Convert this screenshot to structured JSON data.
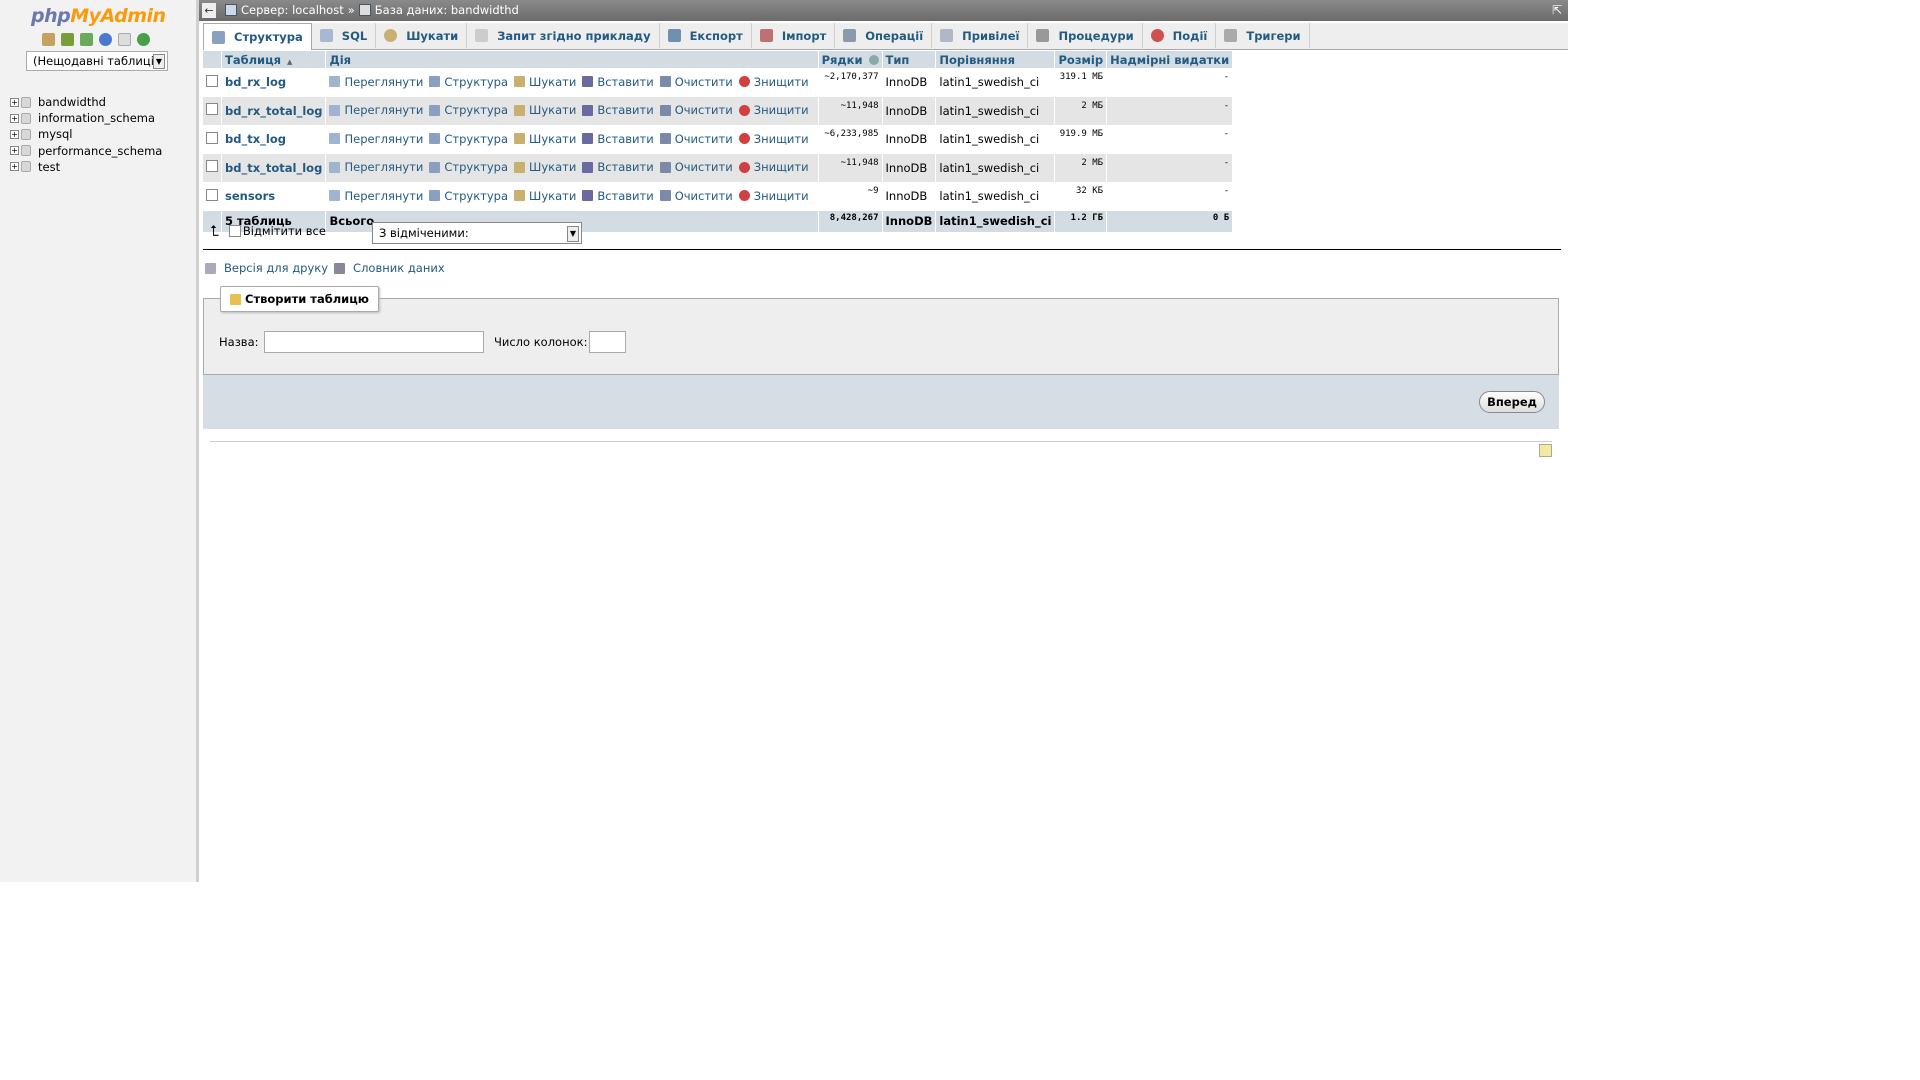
{
  "nav": {
    "logo_php": "php",
    "logo_myadmin": "MyAdmin",
    "recent_tables": "(Нещодавні таблиці)",
    "databases": [
      "bandwidthd",
      "information_schema",
      "mysql",
      "performance_schema",
      "test"
    ]
  },
  "serverinfo": {
    "server": "Сервер: localhost",
    "separator": "»",
    "database": "База даних: bandwidthd"
  },
  "tabs": [
    "Структура",
    "SQL",
    "Шукати",
    "Запит згідно прикладу",
    "Експорт",
    "Імпорт",
    "Операції",
    "Привілеї",
    "Процедури",
    "Події",
    "Тригери"
  ],
  "table": {
    "headers": {
      "table": "Таблиця",
      "action": "Дія",
      "rows": "Рядки",
      "type": "Тип",
      "collation": "Порівняння",
      "size": "Розмір",
      "overhead": "Надмірні видатки"
    },
    "actions": [
      "Переглянути",
      "Структура",
      "Шукати",
      "Вставити",
      "Очистити",
      "Знищити"
    ],
    "rows": [
      {
        "name": "bd_rx_log",
        "rows": "~2,170,377",
        "type": "InnoDB",
        "collation": "latin1_swedish_ci",
        "size": "319.1 МБ",
        "overhead": "-"
      },
      {
        "name": "bd_rx_total_log",
        "rows": "~11,948",
        "type": "InnoDB",
        "collation": "latin1_swedish_ci",
        "size": "2 МБ",
        "overhead": "-"
      },
      {
        "name": "bd_tx_log",
        "rows": "~6,233,985",
        "type": "InnoDB",
        "collation": "latin1_swedish_ci",
        "size": "919.9 МБ",
        "overhead": "-"
      },
      {
        "name": "bd_tx_total_log",
        "rows": "~11,948",
        "type": "InnoDB",
        "collation": "latin1_swedish_ci",
        "size": "2 МБ",
        "overhead": "-"
      },
      {
        "name": "sensors",
        "rows": "~9",
        "type": "InnoDB",
        "collation": "latin1_swedish_ci",
        "size": "32 КБ",
        "overhead": "-"
      }
    ],
    "footer": {
      "count": "5 таблиць",
      "total": "Всього",
      "rows": "8,428,267",
      "type": "InnoDB",
      "collation": "latin1_swedish_ci",
      "size": "1.2 ГБ",
      "overhead": "0 Б"
    }
  },
  "bulk": {
    "check_all": "Відмітити все",
    "with_selected": "З відміченими:"
  },
  "links": {
    "print": "Версія для друку",
    "dictionary": "Словник даних"
  },
  "create": {
    "legend": "Створити таблицю",
    "name_label": "Назва:",
    "name_value": "",
    "cols_label": "Число колонок:",
    "cols_value": "",
    "go": "Вперед"
  },
  "colors": {
    "link": "#235a81",
    "header_bg": "#d3dce3",
    "logo_php": "#6c78af",
    "logo_myadmin": "#f89c0e"
  }
}
